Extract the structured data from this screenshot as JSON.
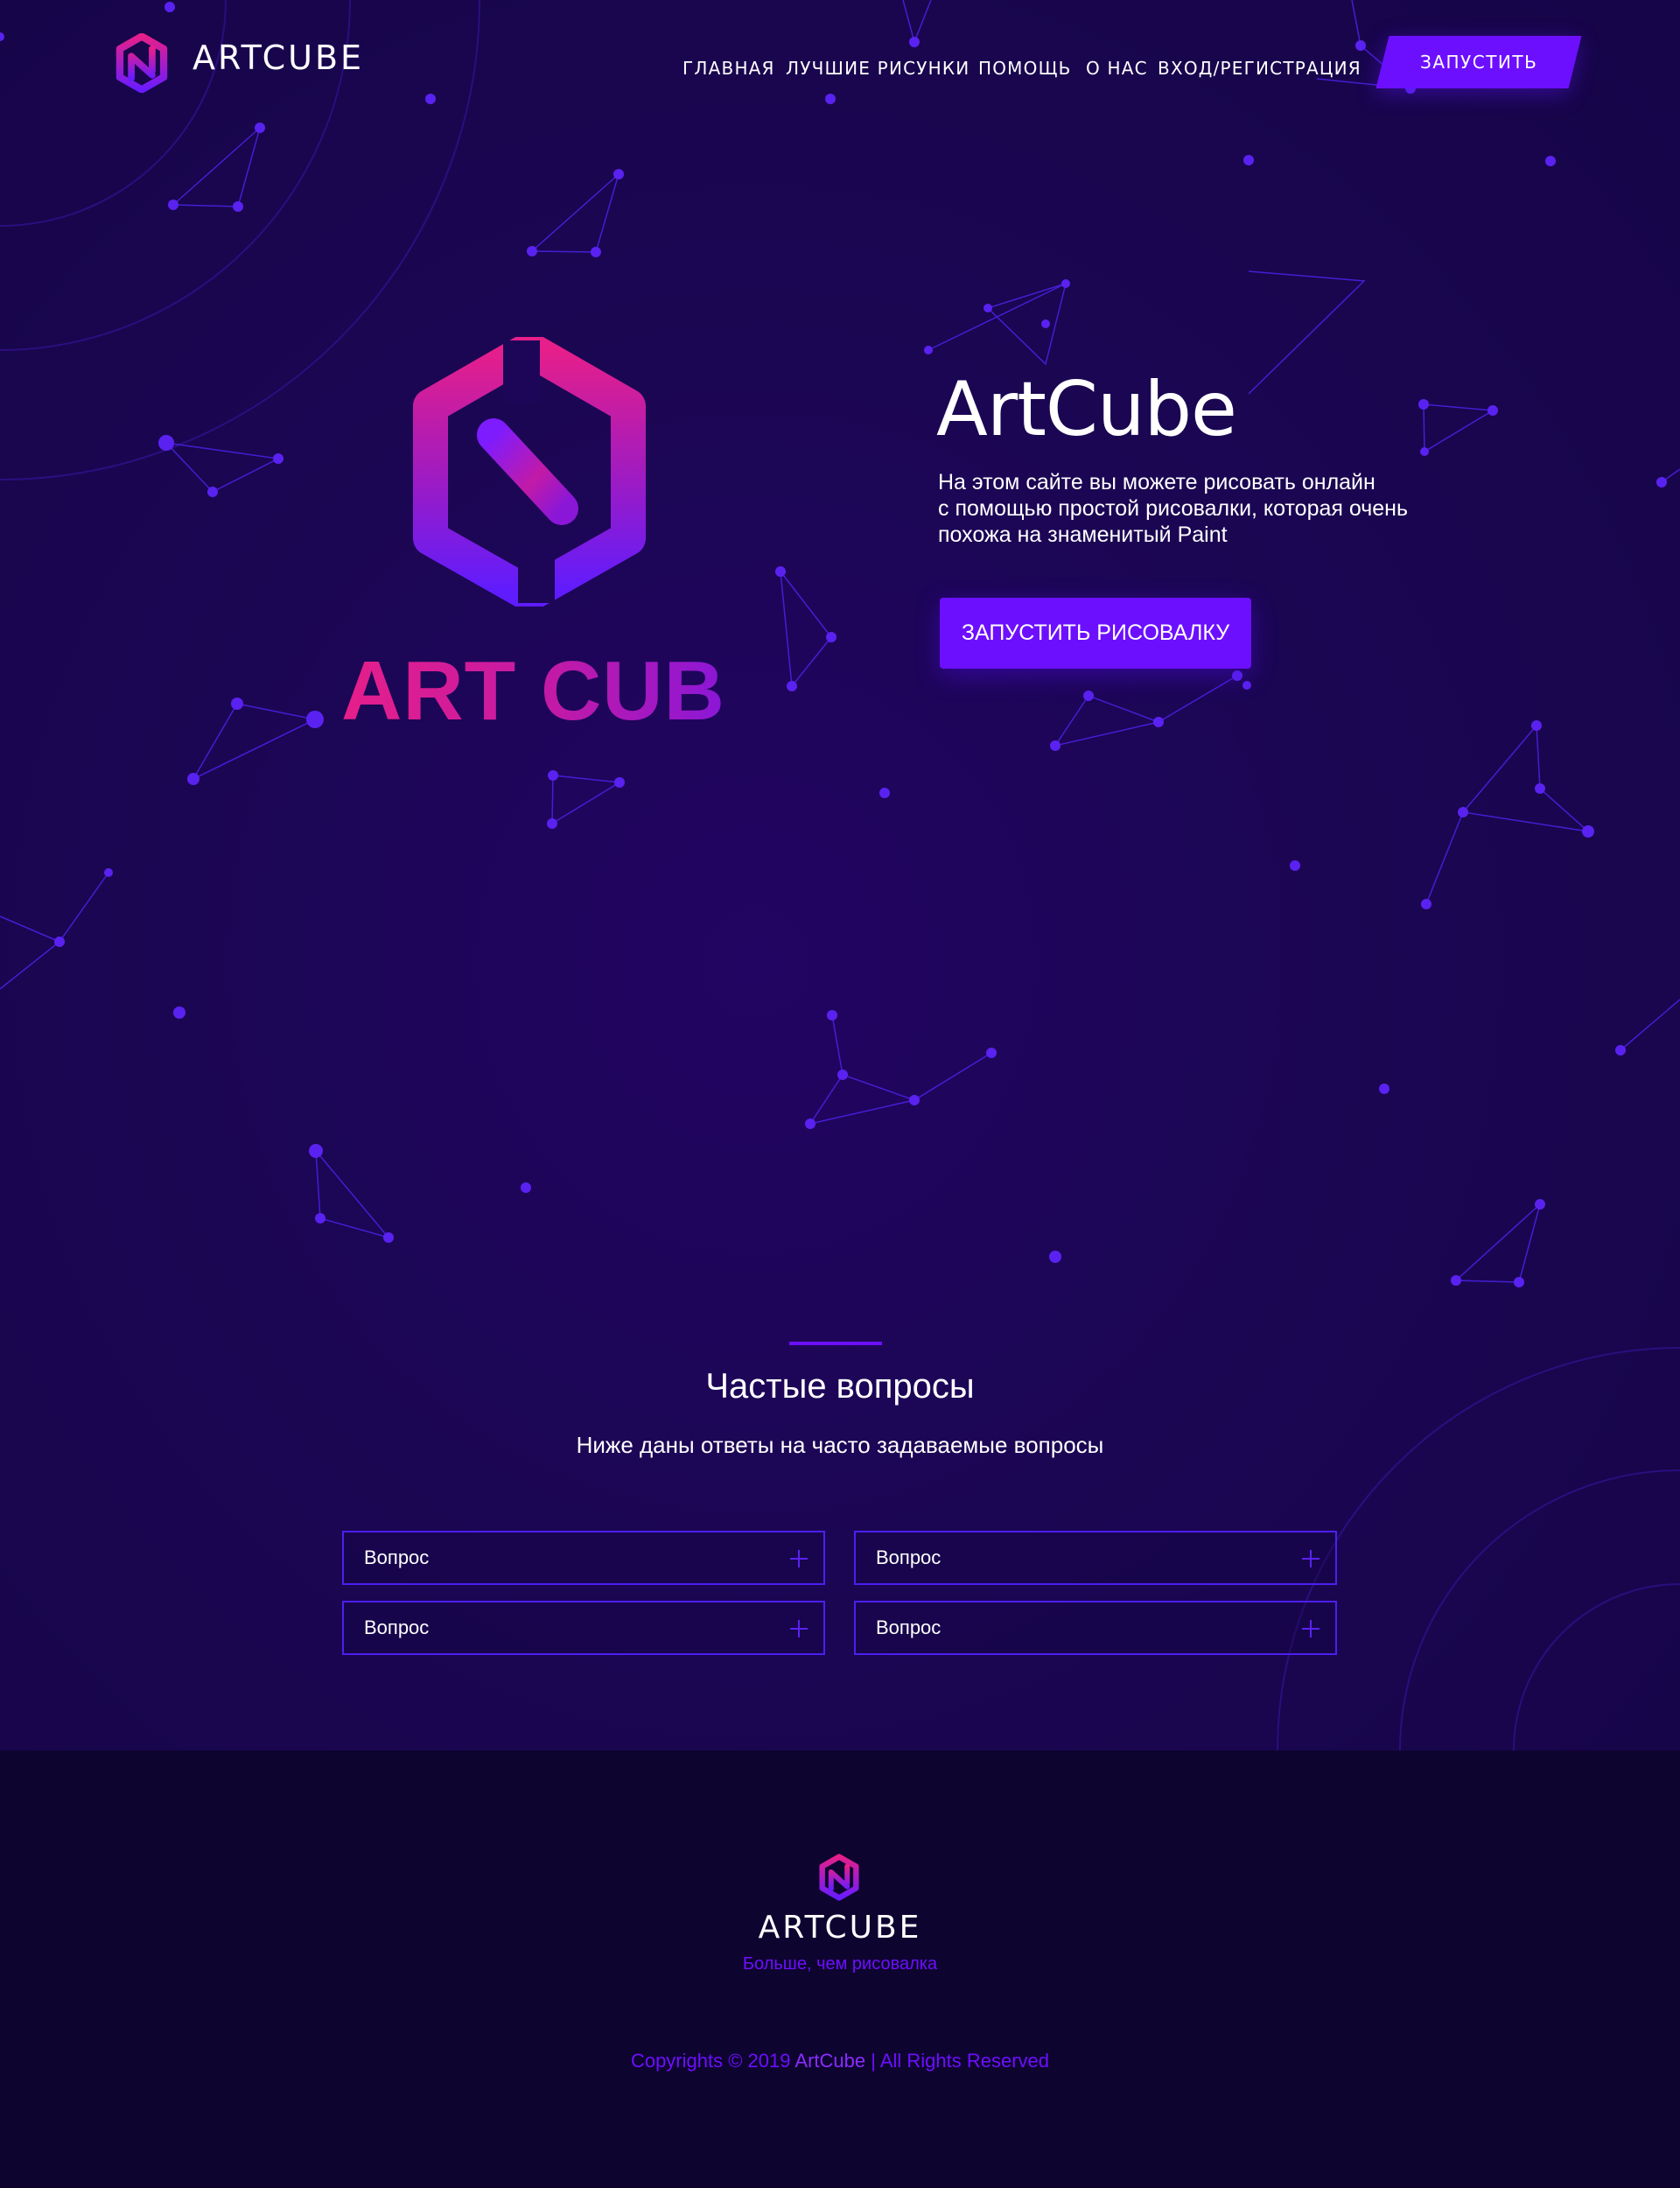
{
  "header": {
    "brand": "ARTCUBE",
    "nav": [
      "ГЛАВНАЯ",
      "ЛУЧШИЕ РИСУНКИ",
      "ПОМОЩЬ",
      "О НАС",
      "ВХОД/РЕГИСТРАЦИЯ"
    ],
    "launch_label": "ЗАПУСТИТЬ",
    "logo_icon": "hexagon-n-logo-icon"
  },
  "hero": {
    "logo_word": "ART CUBE",
    "title": "ArtCube",
    "description_lines": [
      "На этом сайте вы можете рисовать онлайн",
      "с помощью простой рисовалки, которая очень",
      "похожа на знаменитый Paint"
    ],
    "cta_label": "ЗАПУСТИТЬ РИСОВАЛКУ"
  },
  "faq": {
    "title": "Частые вопросы",
    "subtitle": "Ниже даны ответы на часто задаваемые вопросы",
    "items": [
      {
        "question": "Вопрос",
        "icon": "plus-icon"
      },
      {
        "question": "Вопрос",
        "icon": "plus-icon"
      },
      {
        "question": "Вопрос",
        "icon": "plus-icon"
      },
      {
        "question": "Вопрос",
        "icon": "plus-icon"
      }
    ]
  },
  "footer": {
    "brand": "ARTCUBE",
    "tagline": "Больше, чем рисовалка",
    "copyright_prefix": "Copyrights © 2019 ",
    "copyright_brand": "ArtCube",
    "copyright_suffix": " | All Rights Reserved"
  },
  "colors": {
    "background": "#1b0653",
    "footer_background": "#0e0430",
    "accent": "#6d0fff",
    "logo_pink": "#e61f8a",
    "logo_purple": "#6a1bff"
  }
}
